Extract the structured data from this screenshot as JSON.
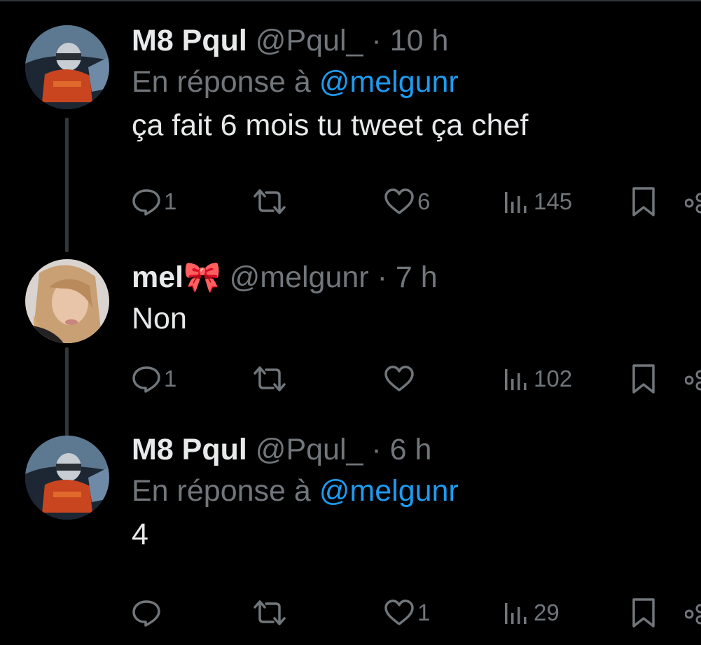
{
  "tweets": [
    {
      "name": "M8 Pqul",
      "handle": "@Pqul_",
      "separator": "·",
      "time": "10 h",
      "reply_prefix": "En réponse à",
      "reply_to": "@melgunr",
      "text": "ça fait 6 mois tu tweet ça chef",
      "replies": "1",
      "likes": "6",
      "views": "145"
    },
    {
      "name": "mel🎀",
      "handle": "@melgunr",
      "separator": "·",
      "time": "7 h",
      "text": "Non",
      "replies": "1",
      "views": "102"
    },
    {
      "name": "M8 Pqul",
      "handle": "@Pqul_",
      "separator": "·",
      "time": "6 h",
      "reply_prefix": "En réponse à",
      "reply_to": "@melgunr",
      "text": "4",
      "likes": "1",
      "views": "29"
    }
  ],
  "colors": {
    "background": "#000000",
    "text_primary": "#e7e9ea",
    "text_secondary": "#71767b",
    "accent": "#1d9bf0",
    "thread_line": "#333639"
  },
  "icons": [
    "reply-icon",
    "retweet-icon",
    "like-icon",
    "views-icon",
    "bookmark-icon",
    "share-icon"
  ]
}
